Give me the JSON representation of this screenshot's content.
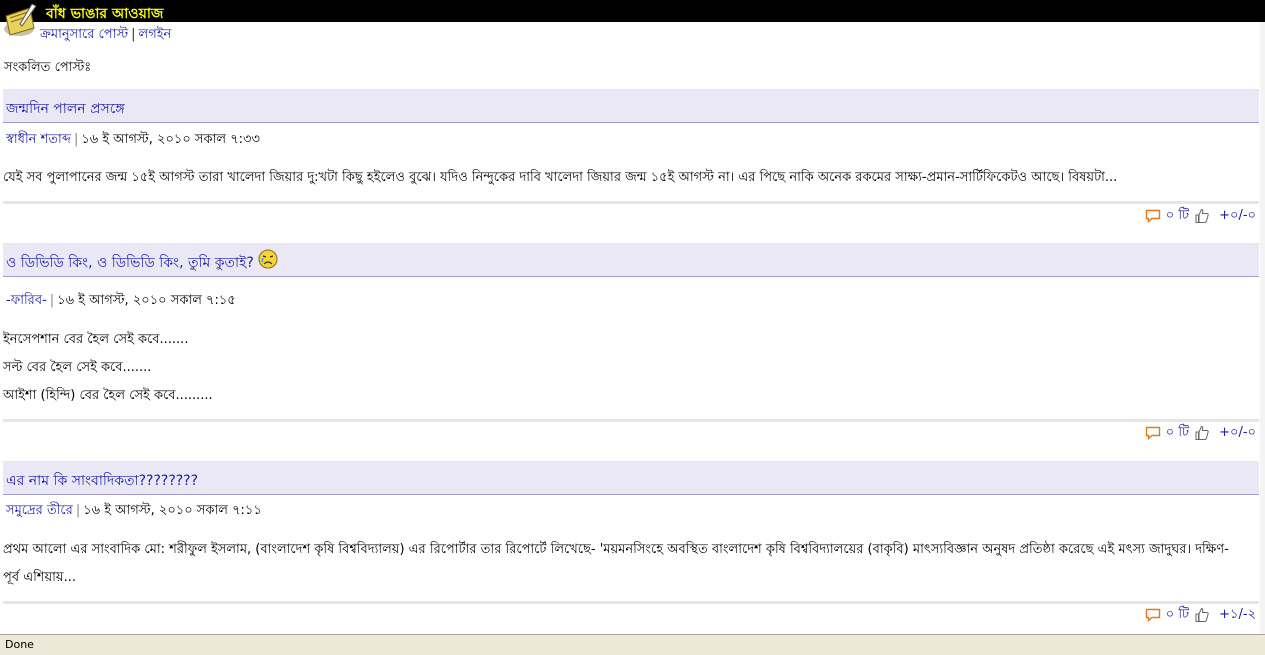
{
  "site": {
    "title": "বাঁধ ভাঙার আওয়াজ"
  },
  "nav": {
    "chrono_label": "ক্রমানুসারে পোস্ট",
    "separator": "|",
    "login_label": "লগইন"
  },
  "section_heading": "সংকলিত পোস্টঃ",
  "posts": [
    {
      "title": "জন্মদিন পালন প্রসঙ্গে",
      "author": "স্বাধীন শতাব্দ",
      "date": "১৬ ই আগস্ট, ২০১০ সকাল ৭:৩৩",
      "lines": [
        "যেই সব পুলাপানের জন্ম ১৫ই আগস্ট তারা খালেদা জিয়ার দু:খটা কিছু হইলেও বুঝে। যদিও নিন্দুকের দাবি খালেদা জিয়ার জন্ম ১৫ই আগস্ট না। এর পিছে নাকি অনেক রকমের সাক্ষ্য-প্রমান-সার্টিফিকেটও আছে। বিষয়টা..."
      ],
      "comments": "০ টি",
      "votes": "+০/-০",
      "has_emoji": false
    },
    {
      "title": "ও ডিভিডি কিং, ও ডিভিডি কিং, তুমি কুতাই?",
      "author": "-ফারিব-",
      "date": "১৬ ই আগস্ট, ২০১০ সকাল ৭:১৫",
      "lines": [
        "ইনসেপশান বের হৈল সেই কবে.......",
        "সল্ট বের হৈল সেই কবে.......",
        "আইশা (হিন্দি) বের হৈল সেই কবে........."
      ],
      "comments": "০ টি",
      "votes": "+০/-০",
      "has_emoji": true
    },
    {
      "title": "এর নাম কি সাংবাদিকতা????????",
      "author": "সমুদ্রের তীরে",
      "date": "১৬ ই আগস্ট, ২০১০ সকাল ৭:১১",
      "lines": [
        "প্রথম আলো এর সাংবাদিক মো: শরীফুল ইসলাম, (বাংলাদেশ কৃষি বিশ্ববিদ্যালয়) এর রিপোর্টার তার রিপোর্টে লিখেছে- 'ময়মনসিংহে অবস্থিত বাংলাদেশ কৃষি বিশ্ববিদ্যালয়ের (বাকৃবি) মাৎস্যবিজ্ঞান অনুষদ প্রতিষ্ঠা করেছে এই মৎস্য জাদুঘর। দক্ষিণ-",
        "পূর্ব এশিয়ায়..."
      ],
      "comments": "০ টি",
      "votes": "+১/-২",
      "has_emoji": false
    }
  ],
  "status": {
    "text": "Done"
  },
  "colors": {
    "link": "#1a1aa6",
    "title_bg": "#ebe8f6",
    "comment_icon": "#e07a1a",
    "topbar": "#000000",
    "site_title": "#ffff00"
  },
  "icons": {
    "comment": "speech-bubble-icon",
    "vote": "thumb-icon",
    "logo": "quill-book-icon",
    "emoji": "crying-face-icon"
  }
}
